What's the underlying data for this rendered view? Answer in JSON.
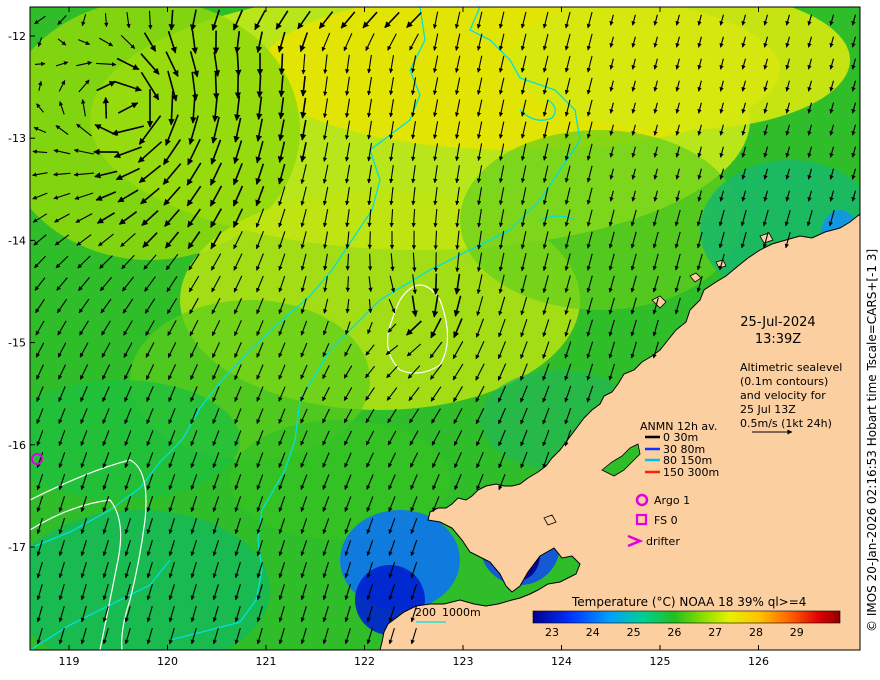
{
  "map": {
    "date": "25-Jul-2024",
    "time": "13:39Z",
    "info_lines": [
      "Altimetric sealevel",
      "(0.1m contours)",
      "and velocity for",
      "25 Jul 13Z",
      "0.5m/s (1kt 24h)"
    ],
    "side_caption": "© IMOS 20-Jan-2026 02:16:53 Hobart time Tscale=CARS+[-1 3]",
    "lon_ticks": [
      "119",
      "120",
      "121",
      "122",
      "123",
      "124",
      "125",
      "126"
    ],
    "lat_ticks": [
      "-12",
      "-13",
      "-14",
      "-15",
      "-16",
      "-17"
    ],
    "colors": {
      "land": "#fbcf9f",
      "isobath": "#00e0e0",
      "contour": "#ffffff",
      "arrow": "#000000",
      "marker": "#e000e0"
    }
  },
  "legend": {
    "title": "ANMN 12h av.",
    "items": [
      {
        "label": "0 30m",
        "color": "#000000"
      },
      {
        "label": "30 80m",
        "color": "#1030ff"
      },
      {
        "label": "80 150m",
        "color": "#00c0e0"
      },
      {
        "label": "150 300m",
        "color": "#ff2000"
      }
    ],
    "markers": [
      {
        "label": "Argo 1",
        "icon": "circle-marker"
      },
      {
        "label": "FS 0",
        "icon": "square-marker"
      },
      {
        "label": "drifter",
        "icon": "chevron-marker"
      }
    ]
  },
  "isobath_legend": {
    "label_a": "200",
    "label_b": "1000m"
  },
  "colorbar": {
    "title": "Temperature (°C) NOAA 18 39% ql>=4",
    "ticks": [
      "23",
      "24",
      "25",
      "26",
      "27",
      "28",
      "29"
    ]
  }
}
